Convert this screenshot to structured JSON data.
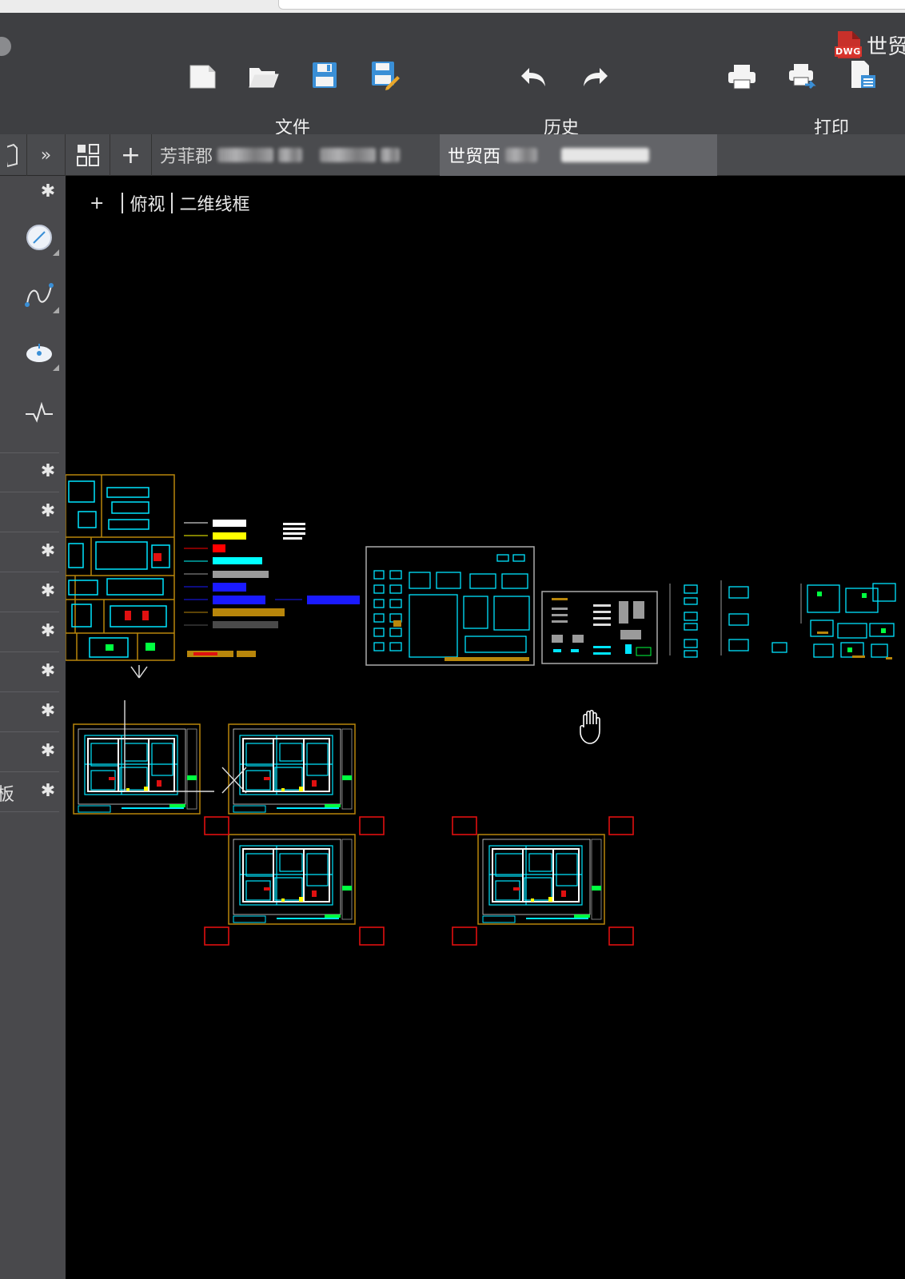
{
  "header": {
    "document_title": "世贸",
    "file_badge": "DWG",
    "groups": [
      {
        "label": "文件"
      },
      {
        "label": "历史"
      },
      {
        "label": "打印"
      }
    ]
  },
  "toolbar": {
    "file_tools": [
      "new-file-icon",
      "open-folder-icon",
      "save-icon",
      "save-as-icon"
    ],
    "history_tools": [
      "undo-icon",
      "redo-icon"
    ],
    "print_tools": [
      "print-icon",
      "print-export-icon",
      "print-preview-icon"
    ]
  },
  "tabs": {
    "expand": "»",
    "add": "+",
    "items": [
      {
        "label": "芳菲郡",
        "active": false
      },
      {
        "label": "世贸西",
        "active": true
      }
    ]
  },
  "viewport": {
    "plus": "+",
    "view": "俯视",
    "style": "二维线框"
  },
  "sidebar": {
    "tools": [
      "dimension-icon",
      "spline-icon",
      "point-icon",
      "waveform-icon"
    ],
    "bottom_label": "板"
  },
  "colors": {
    "accent_cyan": "#00ffff",
    "frame_orange": "#b8860b",
    "grip_red": "#e01010",
    "blue": "#1a1aff"
  }
}
